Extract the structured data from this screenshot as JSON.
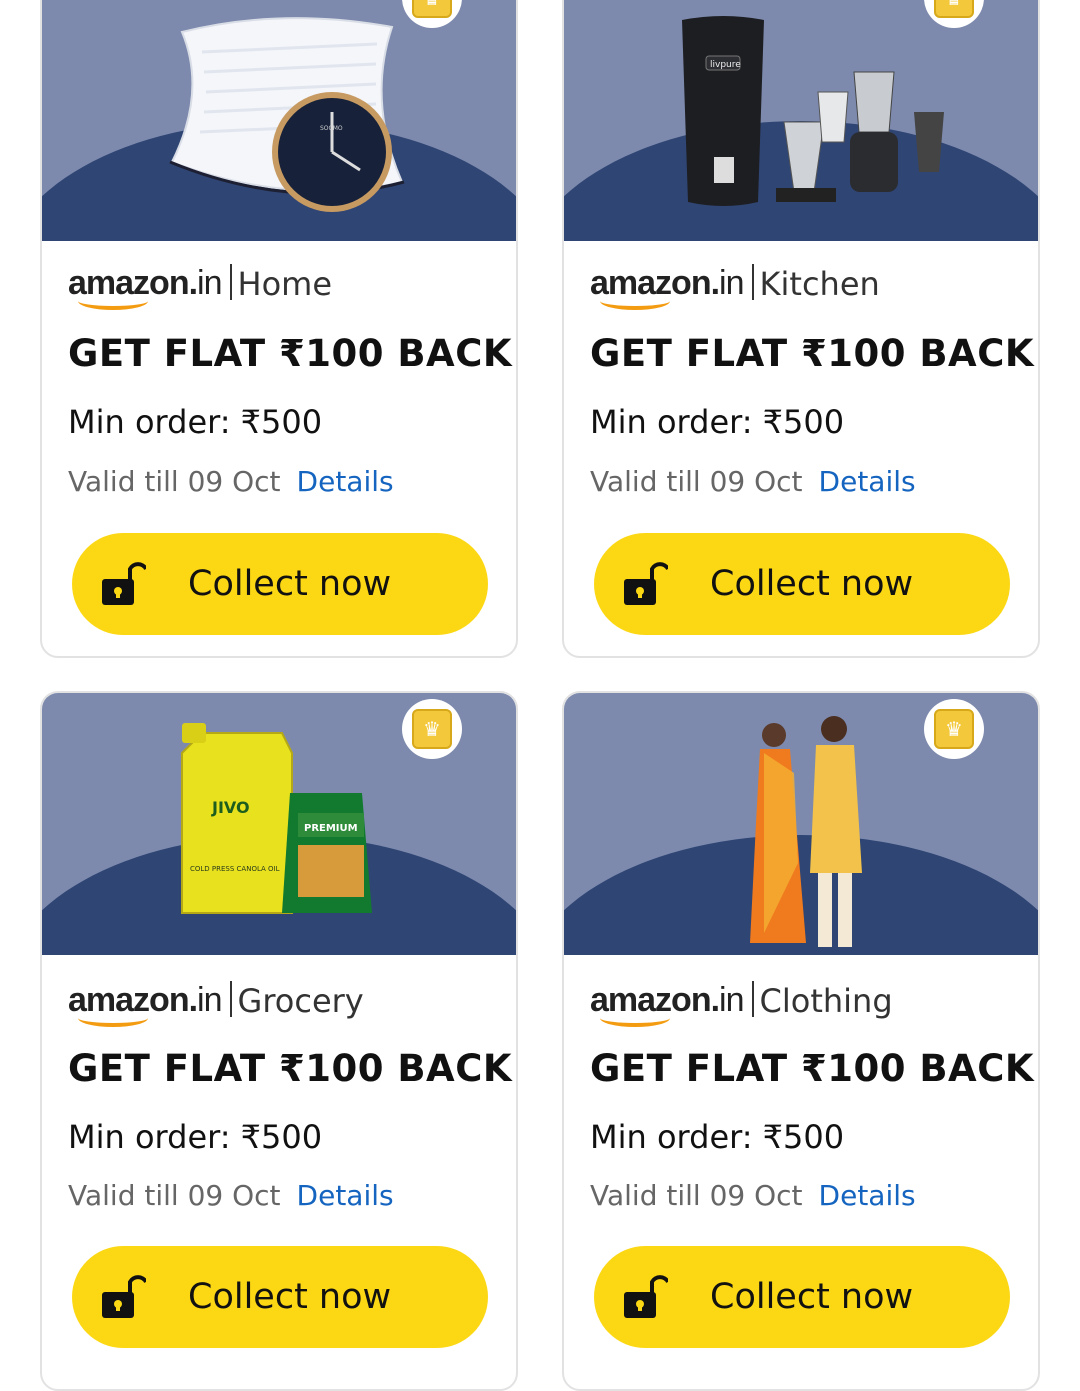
{
  "cards": [
    {
      "brand": "amazon",
      "brand_suffix": "in",
      "category": "Home",
      "title": "GET FLAT ₹100 BACK",
      "min_order": "Min order: ₹500",
      "valid": "Valid till 09 Oct",
      "details": "Details",
      "button": "Collect now"
    },
    {
      "brand": "amazon",
      "brand_suffix": "in",
      "category": "Kitchen",
      "title": "GET FLAT ₹100 BACK",
      "min_order": "Min order: ₹500",
      "valid": "Valid till 09 Oct",
      "details": "Details",
      "button": "Collect now"
    },
    {
      "brand": "amazon",
      "brand_suffix": "in",
      "category": "Grocery",
      "title": "GET FLAT ₹100 BACK",
      "min_order": "Min order: ₹500",
      "valid": "Valid till 09 Oct",
      "details": "Details",
      "button": "Collect now"
    },
    {
      "brand": "amazon",
      "brand_suffix": "in",
      "category": "Clothing",
      "title": "GET FLAT ₹100 BACK",
      "min_order": "Min order: ₹500",
      "valid": "Valid till 09 Oct",
      "details": "Details",
      "button": "Collect now"
    }
  ],
  "products": {
    "kitchen_label": "livpure",
    "grocery_label_1": "JIVO",
    "grocery_label_2": "COLD PRESS CANOLA OIL",
    "grocery_label_3": "PREMIUM"
  },
  "icons": {
    "badge": "crown-badge-icon",
    "button": "unlock-icon"
  },
  "colors": {
    "button": "#fcd814",
    "link": "#1565c0",
    "hero_top": "#7d8aad",
    "hero_wave": "#2f4574"
  }
}
